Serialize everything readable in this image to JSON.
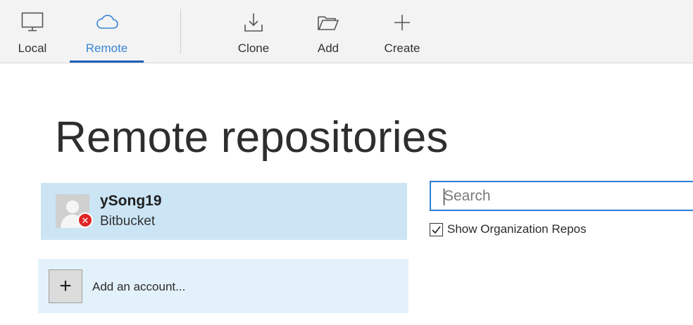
{
  "toolbar": {
    "items": [
      {
        "label": "Local",
        "icon": "monitor-icon",
        "active": false
      },
      {
        "label": "Remote",
        "icon": "cloud-icon",
        "active": true
      },
      {
        "label": "Clone",
        "icon": "download-icon",
        "active": false
      },
      {
        "label": "Add",
        "icon": "folder-open-icon",
        "active": false
      },
      {
        "label": "Create",
        "icon": "plus-icon",
        "active": false
      }
    ]
  },
  "main": {
    "title": "Remote repositories",
    "account": {
      "name": "ySong19",
      "provider": "Bitbucket",
      "status_icon": "error-x-icon"
    },
    "add_account": {
      "label": "Add an account...",
      "icon": "+"
    },
    "search": {
      "placeholder": "Search",
      "value": ""
    },
    "org_repos": {
      "label": "Show Organization Repos",
      "checked": true
    }
  },
  "colors": {
    "accent": "#1e5fb8",
    "active_label": "#3a86d6",
    "account_bg": "#cbe5f5",
    "add_bg": "#e3f1fa",
    "error": "#e02424",
    "search_border": "#2b7fd4"
  }
}
